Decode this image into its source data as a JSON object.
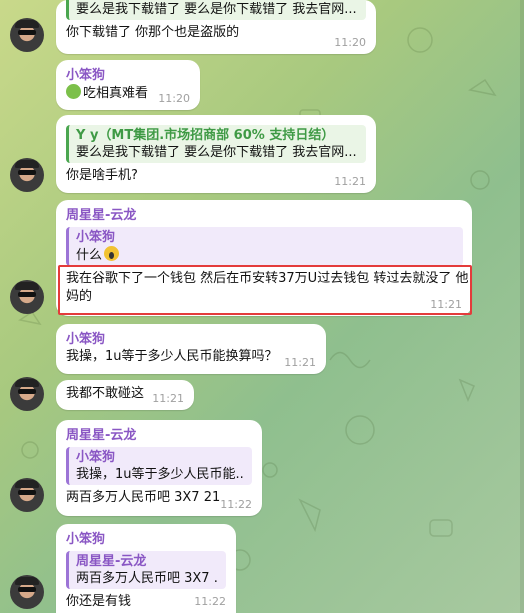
{
  "colors": {
    "accent_purple": "#8a57c4",
    "accent_green": "#3f9a45",
    "highlight": "#e43b3b"
  },
  "m1": {
    "quote": "要么是我下载错了 要么是你下载错了 我去官网...",
    "text": "你下载错了 你那个也是盗版的",
    "time": "11:20"
  },
  "m2": {
    "sender": "小笨狗",
    "emoji": "sick-face-icon",
    "text": "吃相真难看",
    "time": "11:20"
  },
  "m3": {
    "quote_sender": "Y y（MT集团.市场招商部 60% 支持日结）",
    "quote_text": "要么是我下载错了 要么是你下载错了 我去官网...",
    "text": "你是啥手机?",
    "time": "11:21"
  },
  "m4": {
    "sender": "周星星-云龙",
    "quote_sender": "小笨狗",
    "quote_text": "什么",
    "emoji": "scream-face-icon",
    "text_line1": "我在谷歌下了一个钱包 然后在币安转37万U过去钱包 转过去就没了 他",
    "text_line2": "妈的",
    "time": "11:21"
  },
  "m5": {
    "sender": "小笨狗",
    "text": "我操，1u等于多少人民币能换算吗？",
    "time": "11:21"
  },
  "m6": {
    "text": "我都不敢碰这",
    "time": "11:21"
  },
  "m7": {
    "sender": "周星星-云龙",
    "quote_sender": "小笨狗",
    "quote_text": "我操，1u等于多少人民币能...",
    "text": "两百多万人民币吧 3X7 21",
    "time": "11:22"
  },
  "m8": {
    "sender": "小笨狗",
    "quote_sender": "周星星-云龙",
    "quote_text": "两百多万人民币吧 3X7 ...",
    "text": "你还是有钱",
    "time": "11:22"
  }
}
